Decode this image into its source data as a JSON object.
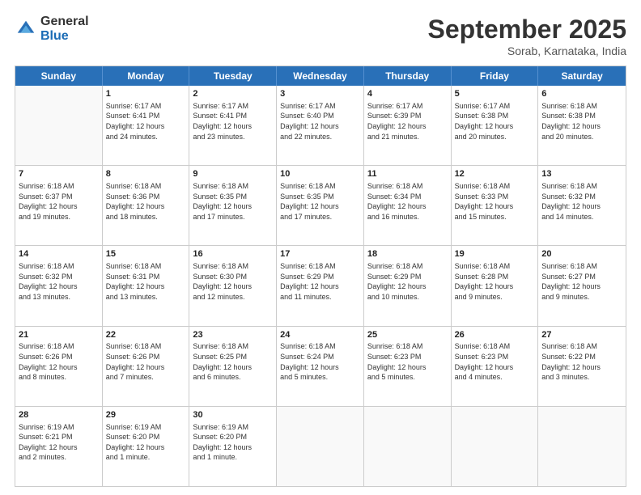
{
  "logo": {
    "general": "General",
    "blue": "Blue"
  },
  "title": "September 2025",
  "subtitle": "Sorab, Karnataka, India",
  "header_days": [
    "Sunday",
    "Monday",
    "Tuesday",
    "Wednesday",
    "Thursday",
    "Friday",
    "Saturday"
  ],
  "rows": [
    [
      {
        "day": "",
        "info": ""
      },
      {
        "day": "1",
        "info": "Sunrise: 6:17 AM\nSunset: 6:41 PM\nDaylight: 12 hours\nand 24 minutes."
      },
      {
        "day": "2",
        "info": "Sunrise: 6:17 AM\nSunset: 6:41 PM\nDaylight: 12 hours\nand 23 minutes."
      },
      {
        "day": "3",
        "info": "Sunrise: 6:17 AM\nSunset: 6:40 PM\nDaylight: 12 hours\nand 22 minutes."
      },
      {
        "day": "4",
        "info": "Sunrise: 6:17 AM\nSunset: 6:39 PM\nDaylight: 12 hours\nand 21 minutes."
      },
      {
        "day": "5",
        "info": "Sunrise: 6:17 AM\nSunset: 6:38 PM\nDaylight: 12 hours\nand 20 minutes."
      },
      {
        "day": "6",
        "info": "Sunrise: 6:18 AM\nSunset: 6:38 PM\nDaylight: 12 hours\nand 20 minutes."
      }
    ],
    [
      {
        "day": "7",
        "info": "Sunrise: 6:18 AM\nSunset: 6:37 PM\nDaylight: 12 hours\nand 19 minutes."
      },
      {
        "day": "8",
        "info": "Sunrise: 6:18 AM\nSunset: 6:36 PM\nDaylight: 12 hours\nand 18 minutes."
      },
      {
        "day": "9",
        "info": "Sunrise: 6:18 AM\nSunset: 6:35 PM\nDaylight: 12 hours\nand 17 minutes."
      },
      {
        "day": "10",
        "info": "Sunrise: 6:18 AM\nSunset: 6:35 PM\nDaylight: 12 hours\nand 17 minutes."
      },
      {
        "day": "11",
        "info": "Sunrise: 6:18 AM\nSunset: 6:34 PM\nDaylight: 12 hours\nand 16 minutes."
      },
      {
        "day": "12",
        "info": "Sunrise: 6:18 AM\nSunset: 6:33 PM\nDaylight: 12 hours\nand 15 minutes."
      },
      {
        "day": "13",
        "info": "Sunrise: 6:18 AM\nSunset: 6:32 PM\nDaylight: 12 hours\nand 14 minutes."
      }
    ],
    [
      {
        "day": "14",
        "info": "Sunrise: 6:18 AM\nSunset: 6:32 PM\nDaylight: 12 hours\nand 13 minutes."
      },
      {
        "day": "15",
        "info": "Sunrise: 6:18 AM\nSunset: 6:31 PM\nDaylight: 12 hours\nand 13 minutes."
      },
      {
        "day": "16",
        "info": "Sunrise: 6:18 AM\nSunset: 6:30 PM\nDaylight: 12 hours\nand 12 minutes."
      },
      {
        "day": "17",
        "info": "Sunrise: 6:18 AM\nSunset: 6:29 PM\nDaylight: 12 hours\nand 11 minutes."
      },
      {
        "day": "18",
        "info": "Sunrise: 6:18 AM\nSunset: 6:29 PM\nDaylight: 12 hours\nand 10 minutes."
      },
      {
        "day": "19",
        "info": "Sunrise: 6:18 AM\nSunset: 6:28 PM\nDaylight: 12 hours\nand 9 minutes."
      },
      {
        "day": "20",
        "info": "Sunrise: 6:18 AM\nSunset: 6:27 PM\nDaylight: 12 hours\nand 9 minutes."
      }
    ],
    [
      {
        "day": "21",
        "info": "Sunrise: 6:18 AM\nSunset: 6:26 PM\nDaylight: 12 hours\nand 8 minutes."
      },
      {
        "day": "22",
        "info": "Sunrise: 6:18 AM\nSunset: 6:26 PM\nDaylight: 12 hours\nand 7 minutes."
      },
      {
        "day": "23",
        "info": "Sunrise: 6:18 AM\nSunset: 6:25 PM\nDaylight: 12 hours\nand 6 minutes."
      },
      {
        "day": "24",
        "info": "Sunrise: 6:18 AM\nSunset: 6:24 PM\nDaylight: 12 hours\nand 5 minutes."
      },
      {
        "day": "25",
        "info": "Sunrise: 6:18 AM\nSunset: 6:23 PM\nDaylight: 12 hours\nand 5 minutes."
      },
      {
        "day": "26",
        "info": "Sunrise: 6:18 AM\nSunset: 6:23 PM\nDaylight: 12 hours\nand 4 minutes."
      },
      {
        "day": "27",
        "info": "Sunrise: 6:18 AM\nSunset: 6:22 PM\nDaylight: 12 hours\nand 3 minutes."
      }
    ],
    [
      {
        "day": "28",
        "info": "Sunrise: 6:19 AM\nSunset: 6:21 PM\nDaylight: 12 hours\nand 2 minutes."
      },
      {
        "day": "29",
        "info": "Sunrise: 6:19 AM\nSunset: 6:20 PM\nDaylight: 12 hours\nand 1 minute."
      },
      {
        "day": "30",
        "info": "Sunrise: 6:19 AM\nSunset: 6:20 PM\nDaylight: 12 hours\nand 1 minute."
      },
      {
        "day": "",
        "info": ""
      },
      {
        "day": "",
        "info": ""
      },
      {
        "day": "",
        "info": ""
      },
      {
        "day": "",
        "info": ""
      }
    ]
  ]
}
